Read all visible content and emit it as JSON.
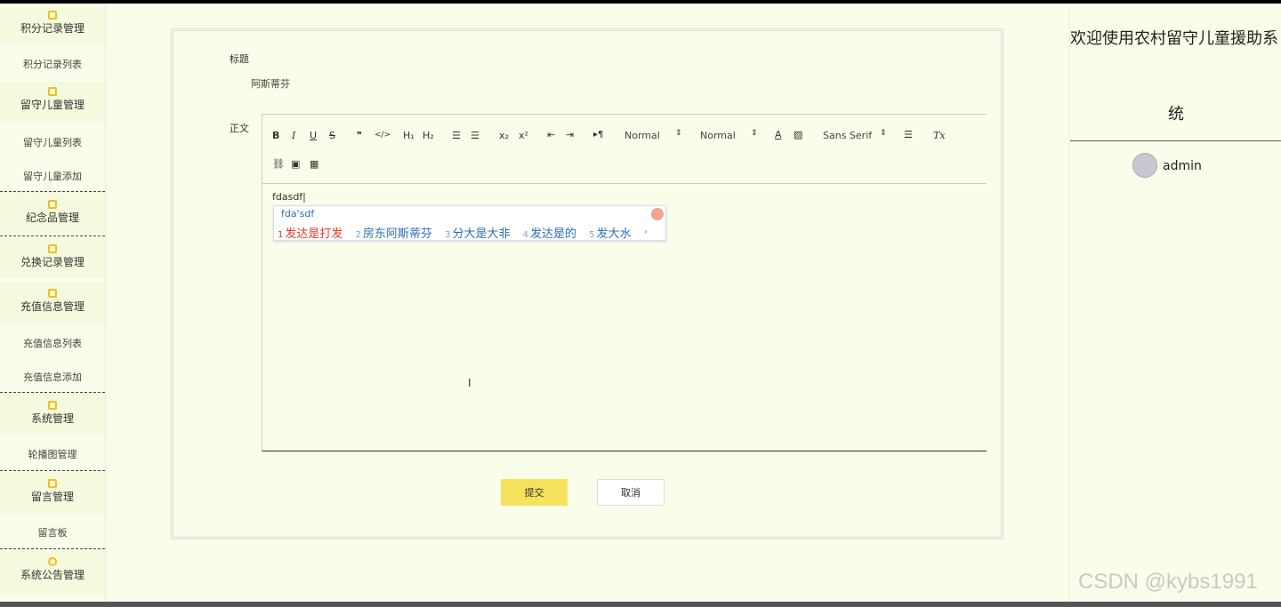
{
  "sidebar": {
    "items": [
      {
        "label": "积分记录管理",
        "type": "group",
        "icon": "edit-icon"
      },
      {
        "label": "积分记录列表",
        "type": "sub"
      },
      {
        "label": "留守儿童管理",
        "type": "group",
        "icon": "edit-icon"
      },
      {
        "label": "留守儿童列表",
        "type": "sub"
      },
      {
        "label": "留守儿童添加",
        "type": "sub"
      },
      {
        "label": "纪念品管理",
        "type": "group",
        "icon": "edit-icon"
      },
      {
        "label": "兑换记录管理",
        "type": "group",
        "icon": "edit-icon"
      },
      {
        "label": "充值信息管理",
        "type": "group",
        "icon": "edit-icon"
      },
      {
        "label": "充值信息列表",
        "type": "sub"
      },
      {
        "label": "充值信息添加",
        "type": "sub"
      },
      {
        "label": "系统管理",
        "type": "group",
        "icon": "picture-icon"
      },
      {
        "label": "轮播图管理",
        "type": "sub"
      },
      {
        "label": "留言管理",
        "type": "group",
        "icon": "picture-icon"
      },
      {
        "label": "留言板",
        "type": "sub"
      },
      {
        "label": "系统公告管理",
        "type": "group",
        "icon": "info-icon"
      }
    ]
  },
  "header": {
    "welcome_line1": "欢迎使用农村留守儿童援助系",
    "welcome_line2": "统",
    "username": "admin"
  },
  "form": {
    "title_label": "标题",
    "title_value": "阿斯蒂芬",
    "body_label": "正文",
    "editor_text": "fdasdf|",
    "submit_label": "提交",
    "cancel_label": "取消"
  },
  "toolbar": {
    "bold": "B",
    "italic": "I",
    "underline": "U",
    "strike": "S",
    "quote": "❞",
    "code": "</>",
    "h1": "H₁",
    "h2": "H₂",
    "ordered_list": "☰",
    "bullet_list": "☰",
    "subscript": "x₂",
    "superscript": "x²",
    "outdent": "⇤",
    "indent": "⇥",
    "direction": "▸¶",
    "size_select": "Normal",
    "header_select": "Normal",
    "font_select": "Sans Serif",
    "color": "A",
    "clean": "Tx"
  },
  "ime": {
    "composition": "fda'sdf",
    "candidates": [
      "发达是打发",
      "房东阿斯蒂芬",
      "分大是大非",
      "发达是的",
      "发大水"
    ]
  },
  "watermark": "CSDN @kybs1991",
  "colors": {
    "background": "#fafde9",
    "accent": "#f0c020",
    "submit": "#f7e25d"
  }
}
